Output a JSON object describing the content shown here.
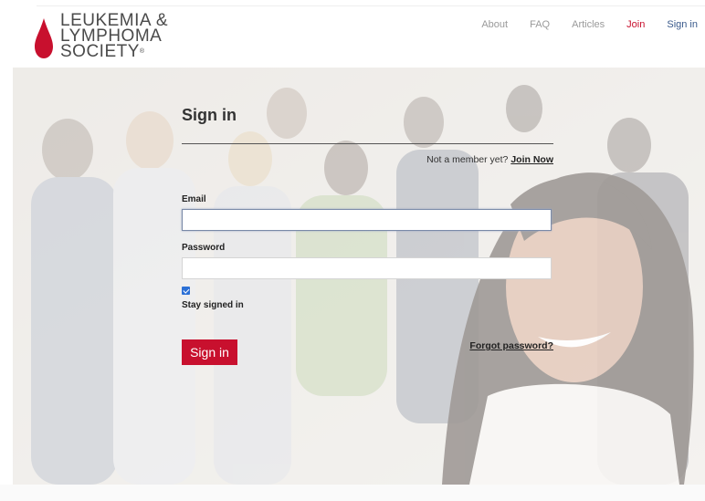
{
  "header": {
    "logo_lines": [
      "LEUKEMIA &",
      "LYMPHOMA",
      "SOCIETY"
    ],
    "logo_mark": "®",
    "nav": [
      {
        "label": "About"
      },
      {
        "label": "FAQ"
      },
      {
        "label": "Articles"
      },
      {
        "label": "Join"
      },
      {
        "label": "Sign in"
      }
    ]
  },
  "form": {
    "title": "Sign in",
    "member_prompt": "Not a member yet?",
    "join_link": "Join Now",
    "email_label": "Email",
    "email_value": "",
    "password_label": "Password",
    "password_value": "",
    "stay_signed_in": "Stay signed in",
    "stay_signed_in_checked": true,
    "submit": "Sign in",
    "forgot": "Forgot password?"
  },
  "colors": {
    "brand_red": "#c8102e",
    "nav_link": "#3a5a8c"
  }
}
